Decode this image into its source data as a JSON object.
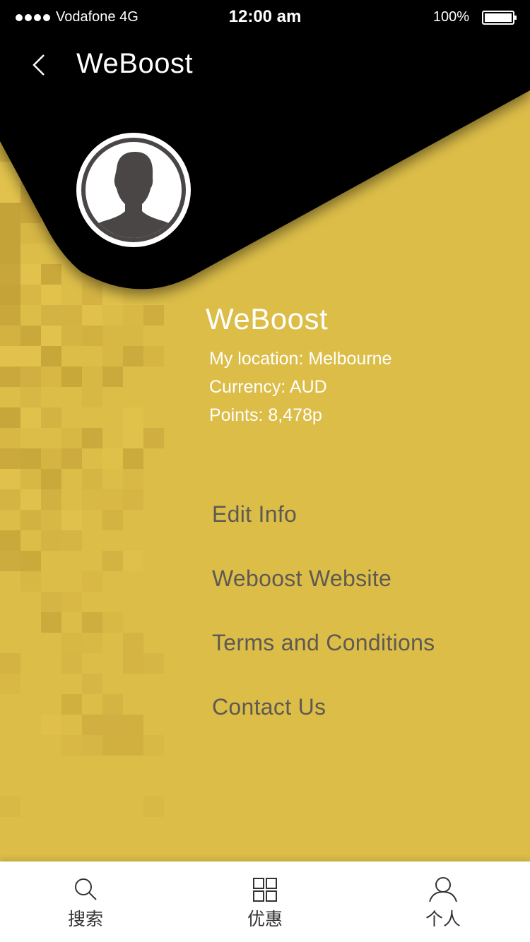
{
  "status_bar": {
    "carrier": "Vodafone 4G",
    "time": "12:00 am",
    "battery": "100%"
  },
  "nav": {
    "title": "WeBoost",
    "back_icon": "chevron-left-icon"
  },
  "profile": {
    "name": "WeBoost",
    "location": "My location: Melbourne",
    "currency": "Currency: AUD",
    "points": "Points: 8,478p",
    "avatar_icon": "user-silhouette-icon"
  },
  "menu": {
    "items": [
      {
        "label": "Edit Info"
      },
      {
        "label": "Weboost Website"
      },
      {
        "label": "Terms and Conditions"
      },
      {
        "label": "Contact Us"
      }
    ]
  },
  "tabbar": {
    "tabs": [
      {
        "label": "搜索",
        "icon": "search-icon"
      },
      {
        "label": "优惠",
        "icon": "grid-icon"
      },
      {
        "label": "个人",
        "icon": "person-icon"
      }
    ]
  },
  "colors": {
    "background": "#dcbd48",
    "header": "#000000",
    "menu_text": "#5e5a52",
    "profile_text": "#ffffff"
  }
}
